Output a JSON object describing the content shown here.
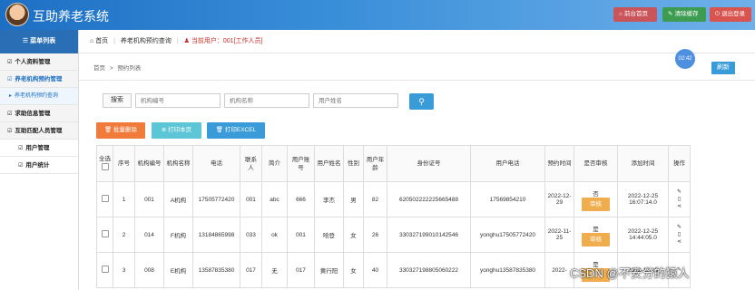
{
  "app": {
    "title": "互助养老系统"
  },
  "topbar": {
    "home_label": "前台首页",
    "cache_label": "清除缓存",
    "logout_label": "退出登录"
  },
  "sidebar": {
    "header": "菜单列表",
    "items": [
      {
        "label": "个人资料管理"
      },
      {
        "label": "养老机构预约管理"
      },
      {
        "label": "养老机构预约查询"
      },
      {
        "label": "求助信息管理"
      },
      {
        "label": "互助匹配人员管理"
      },
      {
        "label": "用户管理"
      },
      {
        "label": "用户统计"
      }
    ]
  },
  "breadcrumb": {
    "home": "首页",
    "page": "养老机构预约查询",
    "user": "当前用户：001[工作人员]"
  },
  "badge": {
    "time": "02:42"
  },
  "content": {
    "path_home": "首页",
    "path_sep": ">",
    "path_page": "预约列表",
    "refresh_label": "刷新"
  },
  "search": {
    "label": "搜索",
    "org_no_placeholder": "机构编号",
    "org_name_placeholder": "机构名称",
    "user_name_placeholder": "用户姓名"
  },
  "actions": {
    "batch_delete": "批量删除",
    "print_page": "打印本页",
    "print_excel": "打印EXCEL"
  },
  "table": {
    "headers": [
      "全选",
      "序号",
      "机构编号",
      "机构名称",
      "电话",
      "联系人",
      "简介",
      "用户账号",
      "用户姓名",
      "性别",
      "用户年龄",
      "身份证号",
      "用户电话",
      "预约时间",
      "是否审核",
      "添加时间",
      "操作"
    ],
    "rows": [
      {
        "no": "1",
        "org_no": "001",
        "org_name": "A机构",
        "phone": "17505772420",
        "contact": "001",
        "intro": "abc",
        "account": "666",
        "name": "李杰",
        "gender": "男",
        "age": "82",
        "id_card": "620502222225665488",
        "user_phone": "17569854210",
        "appt_date": "2022-12-29",
        "reviewed": "否",
        "review_btn": "审核",
        "added": "2022-12-25 16:07:14.0"
      },
      {
        "no": "2",
        "org_no": "014",
        "org_name": "F机构",
        "phone": "13184865998",
        "contact": "033",
        "intro": "ok",
        "account": "001",
        "name": "哈登",
        "gender": "女",
        "age": "26",
        "id_card": "330327199010142546",
        "user_phone": "yonghu17505772420",
        "appt_date": "2022-11-25",
        "reviewed": "是",
        "review_btn": "审核",
        "added": "2022-12-25 14:44:05.0"
      },
      {
        "no": "3",
        "org_no": "008",
        "org_name": "E机构",
        "phone": "13587835380",
        "contact": "017",
        "intro": "无",
        "account": "017",
        "name": "黄行阳",
        "gender": "女",
        "age": "40",
        "id_card": "330327198805060222",
        "user_phone": "yonghu13587835380",
        "appt_date": "2022-",
        "reviewed": "是",
        "review_btn": "审核",
        "added": "2022-12-25"
      }
    ]
  },
  "watermark": "CSDN @不安分的猿人"
}
